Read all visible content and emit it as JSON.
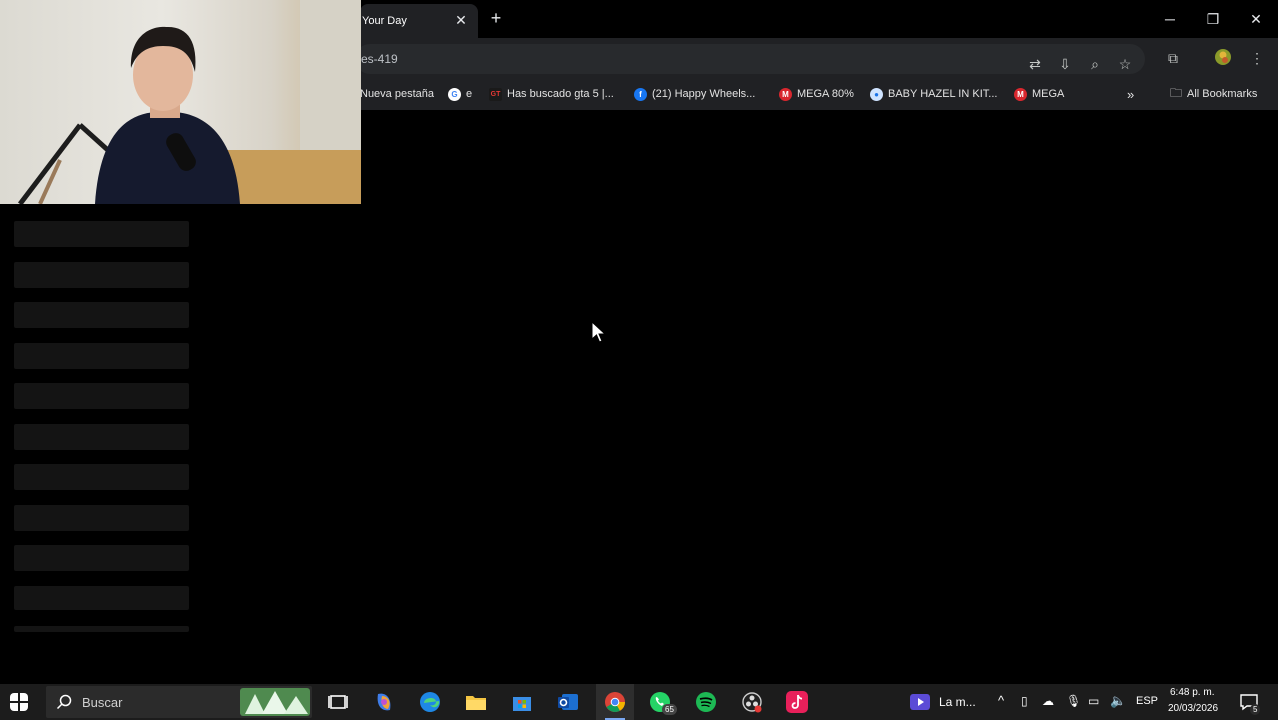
{
  "browser": {
    "tab_title": "Your Day",
    "url_fragment": "es-419",
    "bookmarks": [
      {
        "label": "Nueva pestaña",
        "icon": "none"
      },
      {
        "label": "e",
        "icon": "google-icon"
      },
      {
        "label": "Has buscado gta 5 |...",
        "icon": "gt-icon"
      },
      {
        "label": "(21) Happy Wheels...",
        "icon": "facebook-icon"
      },
      {
        "label": "MEGA 80%",
        "icon": "mega-icon"
      },
      {
        "label": "BABY HAZEL IN KIT...",
        "icon": "globe-icon"
      },
      {
        "label": "MEGA",
        "icon": "mega-icon"
      }
    ],
    "all_bookmarks_label": "All Bookmarks"
  },
  "taskbar": {
    "search_label": "Buscar",
    "whatsapp_badge": "65",
    "media_label": "La m...",
    "language": "ESP",
    "time": "6:48 p. m.",
    "date": "20/03/2026",
    "notification_count": "5"
  },
  "colors": {
    "chrome_bg": "#202124",
    "page_bg": "#000000",
    "skeleton": "#141414",
    "taskbar_bg": "#1c1c1c"
  }
}
